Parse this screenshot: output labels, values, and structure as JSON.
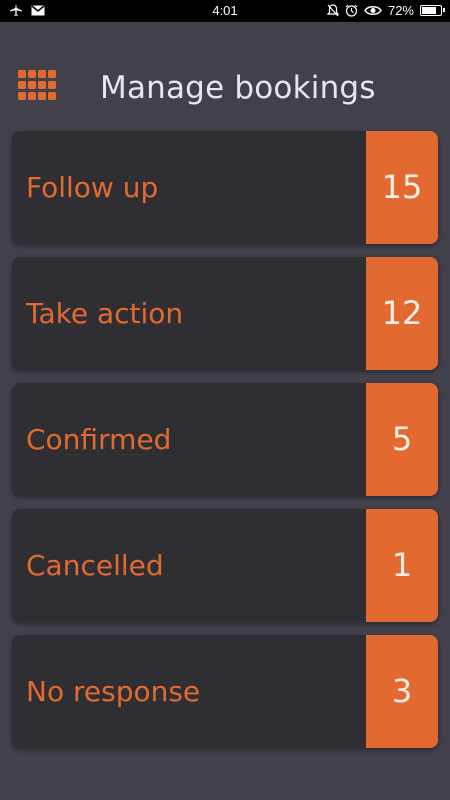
{
  "status_bar": {
    "time": "4:01",
    "battery": "72%",
    "battery_level": 0.72,
    "left_icons": [
      "airplane-icon",
      "mail-icon"
    ],
    "right_icons": [
      "silent-icon",
      "alarm-icon",
      "eye-icon"
    ]
  },
  "header": {
    "title": "Manage bookings",
    "menu_icon": "grid-menu-icon"
  },
  "bookings": [
    {
      "label": "Follow up",
      "count": "15"
    },
    {
      "label": "Take action",
      "count": "12"
    },
    {
      "label": "Confirmed",
      "count": "5"
    },
    {
      "label": "Cancelled",
      "count": "1"
    },
    {
      "label": "No response",
      "count": "3"
    }
  ],
  "colors": {
    "background": "#41404b",
    "card": "#2f2f33",
    "accent": "#e26930",
    "title": "#e6e6ea"
  }
}
